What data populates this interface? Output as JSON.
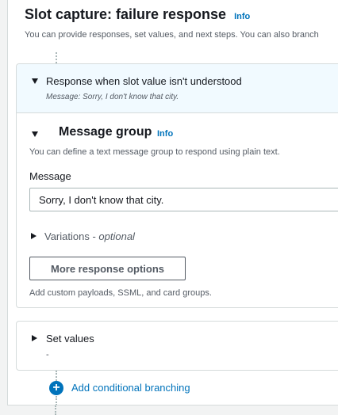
{
  "header": {
    "title": "Slot capture: failure response",
    "info_label": "Info",
    "description": "You can provide responses, set values, and next steps. You can also branch"
  },
  "response_section": {
    "label": "Response when slot value isn't understood",
    "summary": "Message: Sorry, I don't know that city."
  },
  "message_group": {
    "title": "Message group",
    "info_label": "Info",
    "description": "You can define a text message group to respond using plain text.",
    "message_label": "Message",
    "message_value": "Sorry, I don't know that city.",
    "variations_label": "Variations - ",
    "variations_optional": "optional",
    "more_options_label": "More response options",
    "more_options_hint": "Add custom payloads, SSML, and card groups."
  },
  "set_values": {
    "label": "Set values",
    "value": "-"
  },
  "branching": {
    "label": "Add conditional branching"
  },
  "colors": {
    "accent": "#0073bb",
    "header_bg": "#f1faff",
    "border": "#d5dbdb"
  }
}
